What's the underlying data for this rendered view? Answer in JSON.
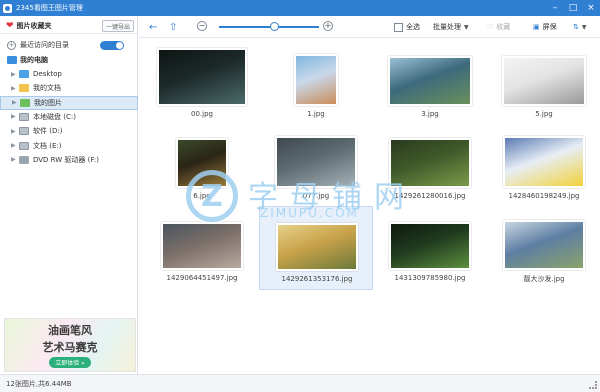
{
  "window": {
    "title": "2345看图王图片管理"
  },
  "sidebar": {
    "favorites_label": "图片收藏夹",
    "export_label": "一键导出",
    "recent_label": "最近访问的目录",
    "recent_toggle_on": true,
    "my_computer_label": "我的电脑",
    "items": [
      {
        "label": "Desktop",
        "icon": "desktop-icon",
        "selected": false
      },
      {
        "label": "我的文档",
        "icon": "folder-icon",
        "selected": false
      },
      {
        "label": "我的图片",
        "icon": "pictures-folder-icon",
        "selected": true
      },
      {
        "label": "本地磁盘 (C:)",
        "icon": "disk-icon",
        "selected": false
      },
      {
        "label": "软件 (D:)",
        "icon": "disk-icon",
        "selected": false
      },
      {
        "label": "文档 (E:)",
        "icon": "disk-icon",
        "selected": false
      },
      {
        "label": "DVD RW 驱动器 (F:)",
        "icon": "dvd-icon",
        "selected": false
      }
    ],
    "ad": {
      "line1": "油画笔风",
      "line2": "艺术马赛克",
      "button": "立即体验 »"
    }
  },
  "toolbar": {
    "select_all": "全选",
    "batch": "批量处理",
    "favorite": "收藏",
    "screen": "屏保",
    "zoom_level": 0.55
  },
  "files": [
    {
      "name": "00.jpg",
      "colors": [
        "#1d2a2a",
        "#4b6b6a",
        "#0e1414"
      ],
      "selected": false
    },
    {
      "name": "1.jpg",
      "colors": [
        "#c9d8ea",
        "#c98c5a",
        "#7fb6e0"
      ],
      "selected": false
    },
    {
      "name": "3.jpg",
      "colors": [
        "#3d6a7d",
        "#6a8f5a",
        "#9cc0d6"
      ],
      "selected": false
    },
    {
      "name": "5.jpg",
      "colors": [
        "#e3e3e3",
        "#9a9a9a",
        "#f4f4f4"
      ],
      "selected": false
    },
    {
      "name": "6.jpg",
      "colors": [
        "#2b2416",
        "#9a7b3a",
        "#3b4a2a"
      ],
      "selected": false
    },
    {
      "name": "077.jpg",
      "colors": [
        "#5d6b72",
        "#a4b1b6",
        "#3f4a4e"
      ],
      "selected": false
    },
    {
      "name": "1429261280016.jpg",
      "colors": [
        "#3f5a2a",
        "#7c9b4a",
        "#2a3a1e"
      ],
      "selected": false
    },
    {
      "name": "1428460198249.jpg",
      "colors": [
        "#e7eef5",
        "#f2d23a",
        "#5b7ab4"
      ],
      "selected": false
    },
    {
      "name": "1429064451497.jpg",
      "colors": [
        "#7a6e68",
        "#b9a9a0",
        "#4a5560"
      ],
      "selected": false
    },
    {
      "name": "1429261353176.jpg",
      "colors": [
        "#c9a24a",
        "#6c7a3a",
        "#e6d18a"
      ],
      "selected": true
    },
    {
      "name": "1431309785980.jpg",
      "colors": [
        "#1f3b1e",
        "#5e8f3f",
        "#0e1a0e"
      ],
      "selected": false
    },
    {
      "name": "靓大沙发.jpg",
      "colors": [
        "#5e7ea3",
        "#8aa36b",
        "#c9d7e3"
      ],
      "selected": false
    }
  ],
  "watermark": {
    "glyph": "Z",
    "text": "字母铺网",
    "sub": "ZIMUPU.COM"
  },
  "status": {
    "text": "12张图片,共6.44MB"
  }
}
